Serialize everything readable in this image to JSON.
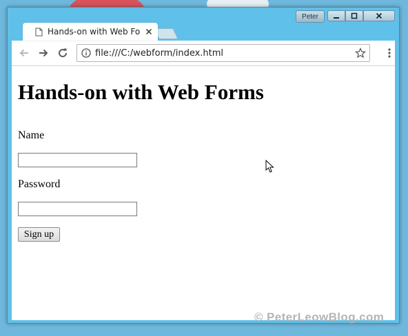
{
  "browser": {
    "tab": {
      "title": "Hands-on with Web Forms",
      "icon": "page-icon",
      "close_icon": "close-icon"
    },
    "profile_name": "Peter",
    "window_controls": {
      "minimize_icon": "minimize-icon",
      "maximize_icon": "maximize-icon",
      "close_icon": "close-icon"
    },
    "toolbar": {
      "back_icon": "back-arrow-icon",
      "forward_icon": "forward-arrow-icon",
      "reload_icon": "reload-icon",
      "info_icon": "info-icon",
      "url": "file:///C:/webform/index.html",
      "bookmark_icon": "star-icon",
      "menu_icon": "kebab-menu-icon"
    }
  },
  "page": {
    "heading": "Hands-on with Web Forms",
    "name_label": "Name",
    "name_value": "",
    "password_label": "Password",
    "password_value": "",
    "submit_label": "Sign up"
  },
  "watermark": "© PeterLeowBlog.com",
  "colors": {
    "window_frame": "#5fc0ea",
    "desktop": "#6fb8dd",
    "page_bg": "#ffffff",
    "watermark": "#b5b5b5"
  }
}
